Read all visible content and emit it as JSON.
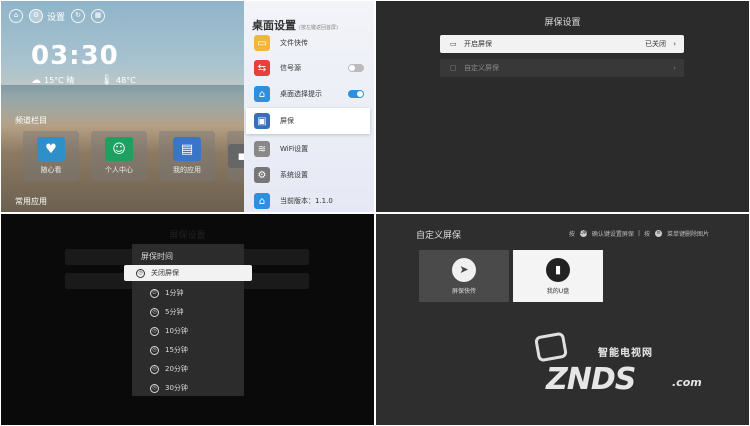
{
  "q1": {
    "top_bar": {
      "settings_label": "设置"
    },
    "clock": "03:30",
    "weather": [
      {
        "icon": "weather-icon",
        "text": "15°C 晴"
      },
      {
        "icon": "temperature-icon",
        "text": "48°C"
      }
    ],
    "section_topics": "频道栏目",
    "tiles": [
      {
        "label": "随心看",
        "icon": "heart-icon",
        "color": "#2e8fc9"
      },
      {
        "label": "个人中心",
        "icon": "person-icon",
        "color": "#1fa060"
      },
      {
        "label": "我的应用",
        "icon": "apps-icon",
        "color": "#3a76c8"
      },
      {
        "label": "",
        "icon": "app-icon",
        "color": "#666666"
      }
    ],
    "section_apps": "常用应用",
    "panel": {
      "title": "桌面设置",
      "subtitle": "(按左键返回首屏)",
      "items": [
        {
          "label": "文件快传",
          "icon": "folder-icon",
          "color": "#f3b63c",
          "toggle": null
        },
        {
          "label": "信号源",
          "icon": "signal-source-icon",
          "color": "#e8413c",
          "toggle": "off"
        },
        {
          "label": "桌面选择提示",
          "icon": "home-icon",
          "color": "#2e8fde",
          "toggle": "on"
        },
        {
          "label": "屏保",
          "icon": "monitor-icon",
          "color": "#3a6fb8",
          "toggle": null,
          "selected": true
        },
        {
          "label": "WiFi设置",
          "icon": "wifi-icon",
          "color": "#888888",
          "toggle": null
        },
        {
          "label": "系统设置",
          "icon": "gear-icon",
          "color": "#777777",
          "toggle": null
        },
        {
          "label": "当前版本：1.1.0",
          "icon": "home-icon",
          "color": "#2e8fde",
          "toggle": null
        }
      ]
    }
  },
  "q2": {
    "title": "屏保设置",
    "options": [
      {
        "label": "开启屏保",
        "value": "已关闭",
        "selected": true
      },
      {
        "label": "自定义屏保",
        "value": "",
        "selected": false
      }
    ]
  },
  "q3": {
    "background_title": "屏保设置",
    "popup": {
      "title": "屏保时间",
      "items": [
        {
          "label": "关闭屏保",
          "selected": true
        },
        {
          "label": "1分钟"
        },
        {
          "label": "5分钟"
        },
        {
          "label": "10分钟"
        },
        {
          "label": "15分钟"
        },
        {
          "label": "20分钟"
        },
        {
          "label": "30分钟"
        }
      ]
    }
  },
  "q4": {
    "title": "自定义屏保",
    "hints": {
      "confirm_prefix": "按",
      "confirm_key": "OK",
      "confirm_text": "确认键设置屏保",
      "separator": "|",
      "menu_prefix": "按",
      "menu_key": "≡",
      "menu_text": "菜单键删除图片"
    },
    "cards": [
      {
        "label": "屏保快传",
        "icon": "telegram-icon"
      },
      {
        "label": "我的U盘",
        "icon": "usb-icon"
      }
    ],
    "watermark": {
      "brand": "智能电视网",
      "logo": "ZNDS",
      "com": ".com"
    }
  }
}
